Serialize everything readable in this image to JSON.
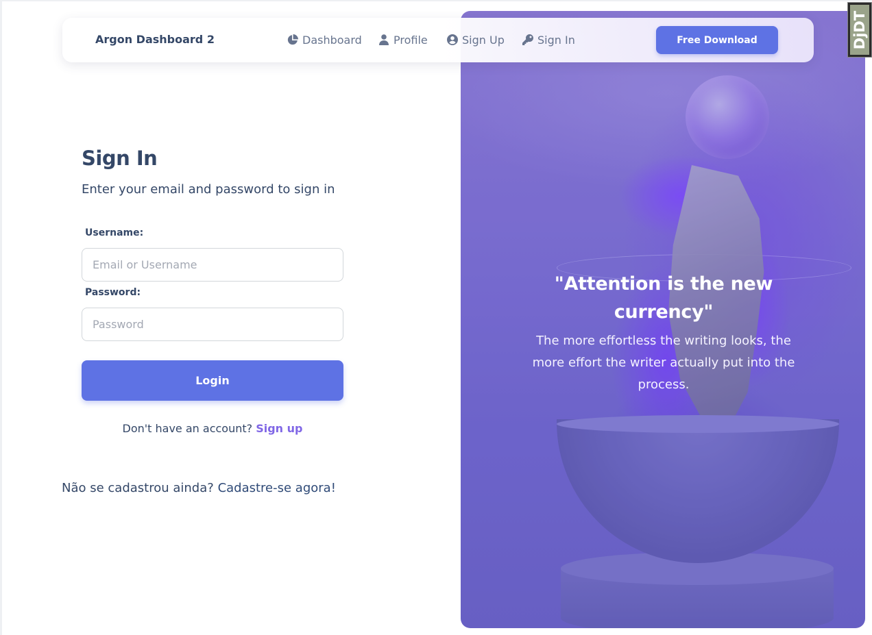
{
  "navbar": {
    "brand": "Argon Dashboard 2",
    "items": [
      {
        "label": "Dashboard",
        "icon": "pie-chart-icon"
      },
      {
        "label": "Profile",
        "icon": "user-icon"
      },
      {
        "label": "Sign Up",
        "icon": "user-circle-icon"
      },
      {
        "label": "Sign In",
        "icon": "key-icon"
      }
    ],
    "download_label": "Free Download"
  },
  "debug_toolbar": {
    "label": "DjDT"
  },
  "signin": {
    "title": "Sign In",
    "subtitle": "Enter your email and password to sign in",
    "username_label": "Username:",
    "username_placeholder": "Email or Username",
    "username_value": "",
    "password_label": "Password:",
    "password_placeholder": "Password",
    "password_value": "",
    "login_label": "Login",
    "account_prompt": "Don't have an account?",
    "signup_link": "Sign up",
    "pt_prompt": "Não se cadastrou ainda?",
    "pt_link": "Cadastre-se agora!"
  },
  "hero": {
    "quote": "\"Attention is the new currency\"",
    "text": "The more effortless the writing looks, the more effort the writer actually put into the process."
  },
  "colors": {
    "primary": "#5e72e4",
    "heading": "#344767",
    "muted": "#67748e",
    "link": "#8067e6",
    "hero": "#7f6fcf"
  }
}
